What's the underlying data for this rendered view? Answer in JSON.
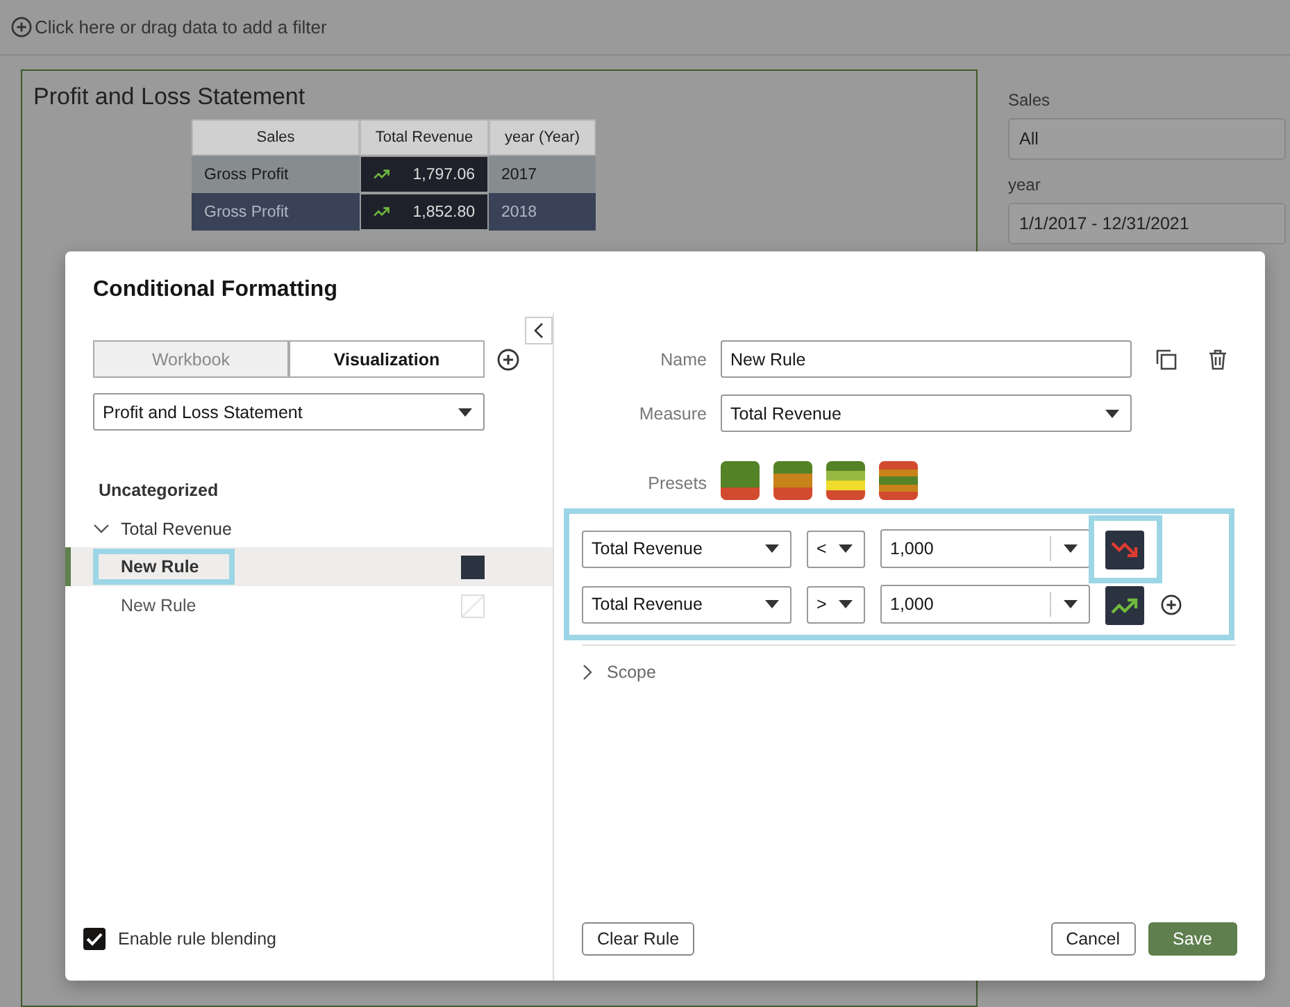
{
  "filter_bar": {
    "label": "Click here or drag data to add a filter"
  },
  "canvas": {
    "title": "Profit and Loss Statement",
    "table": {
      "columns": [
        "Sales",
        "Total Revenue",
        "year (Year)"
      ],
      "rows": [
        {
          "sales": "Gross Profit",
          "revenue": "1,797.06",
          "year": "2017",
          "kind": "up",
          "selected": false
        },
        {
          "sales": "Gross Profit",
          "revenue": "1,852.80",
          "year": "2018",
          "kind": "up",
          "selected": true
        }
      ]
    }
  },
  "filters": [
    {
      "label": "Sales",
      "value": "All"
    },
    {
      "label": "year",
      "value": "1/1/2017 - 12/31/2021"
    }
  ],
  "dialog": {
    "title": "Conditional Formatting",
    "scope_tabs": [
      {
        "label": "Workbook",
        "selected": false
      },
      {
        "label": "Visualization",
        "selected": true
      }
    ],
    "visualization_select": "Profit and Loss Statement",
    "category": "Uncategorized",
    "groups": [
      {
        "label": "Total Revenue",
        "expanded": true,
        "children": [
          {
            "label": "New Rule",
            "selected": true,
            "highlighted": true,
            "kind": "filled"
          },
          {
            "label": "New Rule",
            "selected": false,
            "highlighted": false,
            "kind": "empty"
          }
        ]
      }
    ],
    "enable_blending": {
      "label": "Enable rule blending",
      "checked": true
    },
    "name": {
      "label": "Name",
      "value": "New Rule"
    },
    "measure": {
      "label": "Measure",
      "value": "Total Revenue"
    },
    "presets": {
      "label": "Presets",
      "items": [
        {
          "bands": [
            {
              "color": "#548227"
            },
            {
              "color": "#548227"
            },
            {
              "color": "#d24a2f"
            }
          ]
        },
        {
          "bands": [
            {
              "color": "#548227"
            },
            {
              "color": "#c8821a"
            },
            {
              "color": "#d24a2f"
            }
          ]
        },
        {
          "bands": [
            {
              "color": "#548227"
            },
            {
              "color": "#96b840"
            },
            {
              "color": "#f0dc2c"
            },
            {
              "color": "#d24a2f"
            }
          ]
        },
        {
          "bands": [
            {
              "color": "#d24a2f"
            },
            {
              "color": "#c8821a"
            },
            {
              "color": "#548227"
            },
            {
              "color": "#c8821a"
            },
            {
              "color": "#d24a2f"
            }
          ]
        }
      ]
    },
    "rules_highlighted": true,
    "rules": [
      {
        "measure": "Total Revenue",
        "operator": "<",
        "value": "1,000",
        "kind": "down",
        "highlighted": true
      },
      {
        "measure": "Total Revenue",
        "operator": ">",
        "value": "1,000",
        "kind": "up",
        "highlighted": false
      }
    ],
    "scope": {
      "label": "Scope",
      "expanded": false
    },
    "buttons": {
      "clear": "Clear Rule",
      "cancel": "Cancel",
      "save": "Save"
    }
  }
}
